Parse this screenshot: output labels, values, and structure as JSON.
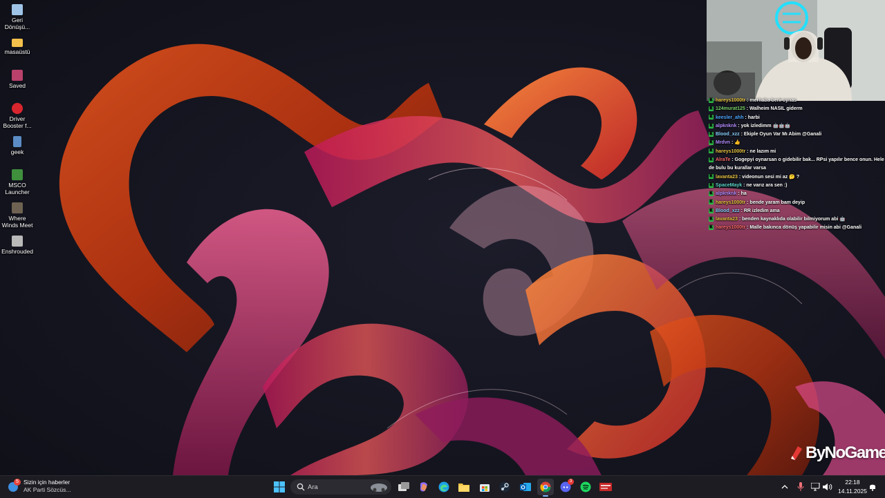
{
  "desktop": {
    "icons": [
      {
        "label": "Geri Dönüşü...",
        "icon": "recycle-bin-icon",
        "color": "#9ec3e6"
      },
      {
        "label": "masaüstü",
        "icon": "folder-icon",
        "color": "#f3c04b"
      },
      {
        "label": "Saved",
        "icon": "winrar-icon",
        "color": "#b9416b"
      },
      {
        "label": "Driver Booster f...",
        "icon": "driver-booster-icon",
        "color": "#d8262e"
      },
      {
        "label": "geek",
        "icon": "geek-uninstaller-icon",
        "color": "#5b8cc6"
      },
      {
        "label": "MSCO Launcher",
        "icon": "msco-launcher-icon",
        "color": "#3f8f3d"
      },
      {
        "label": "Where Winds Meet",
        "icon": "where-winds-meet-icon",
        "color": "#6e6252"
      },
      {
        "label": "Enshrouded",
        "icon": "enshrouded-icon",
        "color": "#b9b9b9"
      }
    ]
  },
  "chat": {
    "messages": [
      {
        "user": "hareys1000tr",
        "user_color": "#e8c542",
        "text": " : merhaba beni oynas"
      },
      {
        "user": "124murat125",
        "user_color": "#7ad36a",
        "text": " : Walheim NASIL giderm"
      },
      {
        "user": "keesler_ahh",
        "user_color": "#4fa8ff",
        "text": " : harbi"
      },
      {
        "user": "alpknknk",
        "user_color": "#b48cff",
        "text": " : yok izledimm 🤖🤖🤖"
      },
      {
        "user": "Blood_xzz",
        "user_color": "#8ad1ff",
        "text": " : Ekiple Oyun Var Mı Abim @Ganali"
      },
      {
        "user": "Mrdvn",
        "user_color": "#b48cff",
        "text": " : 👍"
      },
      {
        "user": "hareys1000tr",
        "user_color": "#e8c542",
        "text": " : ne lazım mi"
      },
      {
        "user": "AlraTe",
        "user_color": "#ff6b6b",
        "text": " : Gogepyi oynarsan o gidebilir bak... RPsi yapılır bence onun. Hele de bulu bu kurallar varsa"
      },
      {
        "user": "lavanta23",
        "user_color": "#e8c542",
        "text": " : videonun sesi mi az 🤔 ?"
      },
      {
        "user": "SpaceMayk",
        "user_color": "#5cd6c9",
        "text": " : ne varız ara sen :)"
      },
      {
        "user": "alpknknk",
        "user_color": "#b48cff",
        "text": " : ha"
      },
      {
        "user": "hareys1000tr",
        "user_color": "#e8c542",
        "text": " : bende yaram bam deyip"
      },
      {
        "user": "Blood_xzz",
        "user_color": "#8ad1ff",
        "text": " : RR izledim ama"
      },
      {
        "user": "lavanta23",
        "user_color": "#e8c542",
        "text": " : benden kaynaklıda olabilir bilmiyorum abi 🤖"
      },
      {
        "user": "hareys1000tr",
        "user_color": "#ff6b6b",
        "text": " : Malle bakınca dönüş yapabilir misin abi @Ganali"
      }
    ]
  },
  "watermark": {
    "text": "ByNoGame"
  },
  "taskbar": {
    "news": {
      "title": "Sizin için haberler",
      "subtitle": "AK Parti Sözcüs...",
      "badge": "5"
    },
    "search_placeholder": "Ara",
    "apps": [
      {
        "name": "start",
        "icon": "windows-logo-icon"
      },
      {
        "name": "task-view",
        "icon": "task-view-icon"
      },
      {
        "name": "copilot",
        "icon": "copilot-icon"
      },
      {
        "name": "edge",
        "icon": "edge-icon"
      },
      {
        "name": "file-explorer",
        "icon": "folder-icon"
      },
      {
        "name": "store",
        "icon": "store-icon"
      },
      {
        "name": "steam",
        "icon": "steam-icon"
      },
      {
        "name": "outlook",
        "icon": "outlook-icon"
      },
      {
        "name": "chrome",
        "icon": "chrome-icon"
      },
      {
        "name": "discord",
        "icon": "discord-icon",
        "badge": "3"
      },
      {
        "name": "spotify",
        "icon": "spotify-icon"
      },
      {
        "name": "wuthering",
        "icon": "game-icon"
      }
    ],
    "clock": {
      "time": "22:18",
      "date": "14.11.2025"
    }
  }
}
